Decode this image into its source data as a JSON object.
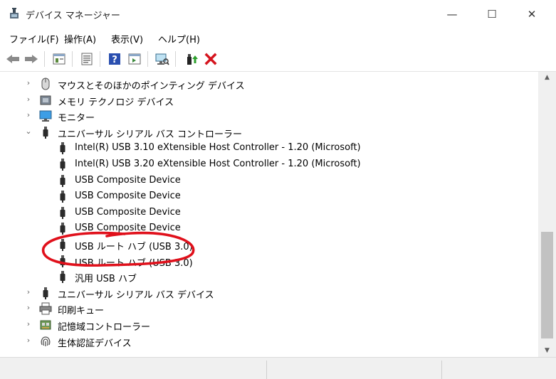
{
  "window": {
    "title": "デバイス マネージャー",
    "min_glyph": "—",
    "max_glyph": "☐",
    "close_glyph": "✕"
  },
  "menu": [
    "ファイル(F)",
    "操作(A)",
    "表示(V)",
    "ヘルプ(H)"
  ],
  "toolbar": [
    "back-icon",
    "forward-icon",
    "properties-panel-icon",
    "device-list-icon",
    "help-icon",
    "action-pane-icon",
    "scan-monitor-icon",
    "update-driver-icon",
    "uninstall-icon"
  ],
  "tree": [
    {
      "label": "マウスとそのほかのポインティング デバイス",
      "arrow": "›",
      "icon": "mouse-icon",
      "level": 0
    },
    {
      "label": "メモリ テクノロジ デバイス",
      "arrow": "›",
      "icon": "memory-icon",
      "level": 0
    },
    {
      "label": "モニター",
      "arrow": "›",
      "icon": "monitor-icon",
      "level": 0
    },
    {
      "label": "ユニバーサル シリアル バス コントローラー",
      "arrow": "⌄",
      "icon": "usb-plug-icon",
      "level": 0
    },
    {
      "label": "Intel(R) USB 3.10 eXtensible Host Controller - 1.20 (Microsoft)",
      "arrow": "",
      "icon": "usb-plug-icon",
      "level": 1
    },
    {
      "label": "Intel(R) USB 3.20 eXtensible Host Controller - 1.20 (Microsoft)",
      "arrow": "",
      "icon": "usb-plug-icon",
      "level": 1
    },
    {
      "label": "USB Composite Device",
      "arrow": "",
      "icon": "usb-plug-icon",
      "level": 1
    },
    {
      "label": "USB Composite Device",
      "arrow": "",
      "icon": "usb-plug-icon",
      "level": 1
    },
    {
      "label": "USB Composite Device",
      "arrow": "",
      "icon": "usb-plug-icon",
      "level": 1
    },
    {
      "label": "USB Composite Device",
      "arrow": "",
      "icon": "usb-plug-icon",
      "level": 1
    },
    {
      "label": "USB ルート ハブ (USB 3.0)",
      "arrow": "",
      "icon": "usb-plug-icon",
      "level": 1
    },
    {
      "label": "USB ルート ハブ (USB 3.0)",
      "arrow": "",
      "icon": "usb-plug-icon",
      "level": 1
    },
    {
      "label": "汎用 USB ハブ",
      "arrow": "",
      "icon": "usb-plug-icon",
      "level": 1
    },
    {
      "label": "ユニバーサル シリアル バス デバイス",
      "arrow": "›",
      "icon": "usb-plug-icon",
      "level": 0
    },
    {
      "label": "印刷キュー",
      "arrow": "›",
      "icon": "printer-icon",
      "level": 0
    },
    {
      "label": "記憶域コントローラー",
      "arrow": "›",
      "icon": "storage-controller-icon",
      "level": 0
    },
    {
      "label": "生体認証デバイス",
      "arrow": "›",
      "icon": "fingerprint-icon",
      "level": 0
    }
  ],
  "scrollbar": {
    "up_glyph": "▲",
    "down_glyph": "▼"
  },
  "annotation": {
    "color": "#e0101b"
  }
}
